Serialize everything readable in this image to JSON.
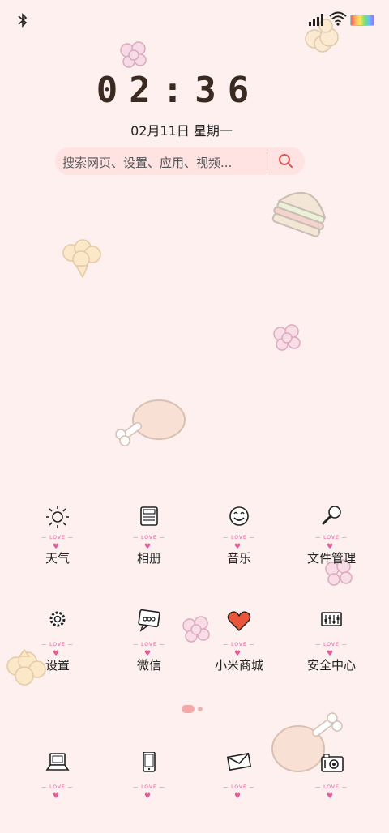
{
  "status_bar": {
    "bluetooth_icon": "bluetooth-icon",
    "signal_icon": "signal-icon",
    "wifi_icon": "wifi-icon",
    "battery_icon": "battery-icon"
  },
  "lockscreen": {
    "time": "02:36",
    "date": "02月11日 星期一"
  },
  "search": {
    "placeholder": "搜索网页、设置、应用、视频...",
    "icon": "search-icon"
  },
  "love_text": "LOVE",
  "apps_row1": [
    {
      "label": "天气",
      "icon": "sun-icon"
    },
    {
      "label": "相册",
      "icon": "gallery-icon"
    },
    {
      "label": "音乐",
      "icon": "smiley-icon"
    },
    {
      "label": "文件管理",
      "icon": "magnifier-icon"
    }
  ],
  "apps_row2": [
    {
      "label": "设置",
      "icon": "gear-icon"
    },
    {
      "label": "微信",
      "icon": "chat-icon"
    },
    {
      "label": "小米商城",
      "icon": "heart-icon"
    },
    {
      "label": "安全中心",
      "icon": "equalizer-icon"
    }
  ],
  "dock": [
    {
      "icon": "laptop-icon"
    },
    {
      "icon": "phone-icon"
    },
    {
      "icon": "envelope-icon"
    },
    {
      "icon": "camera-icon"
    }
  ],
  "page_indicator": {
    "pages": 2,
    "active": 1
  },
  "colors": {
    "background": "#fdf0ee",
    "accent": "#e65a9a",
    "search_accent": "#e57777"
  }
}
